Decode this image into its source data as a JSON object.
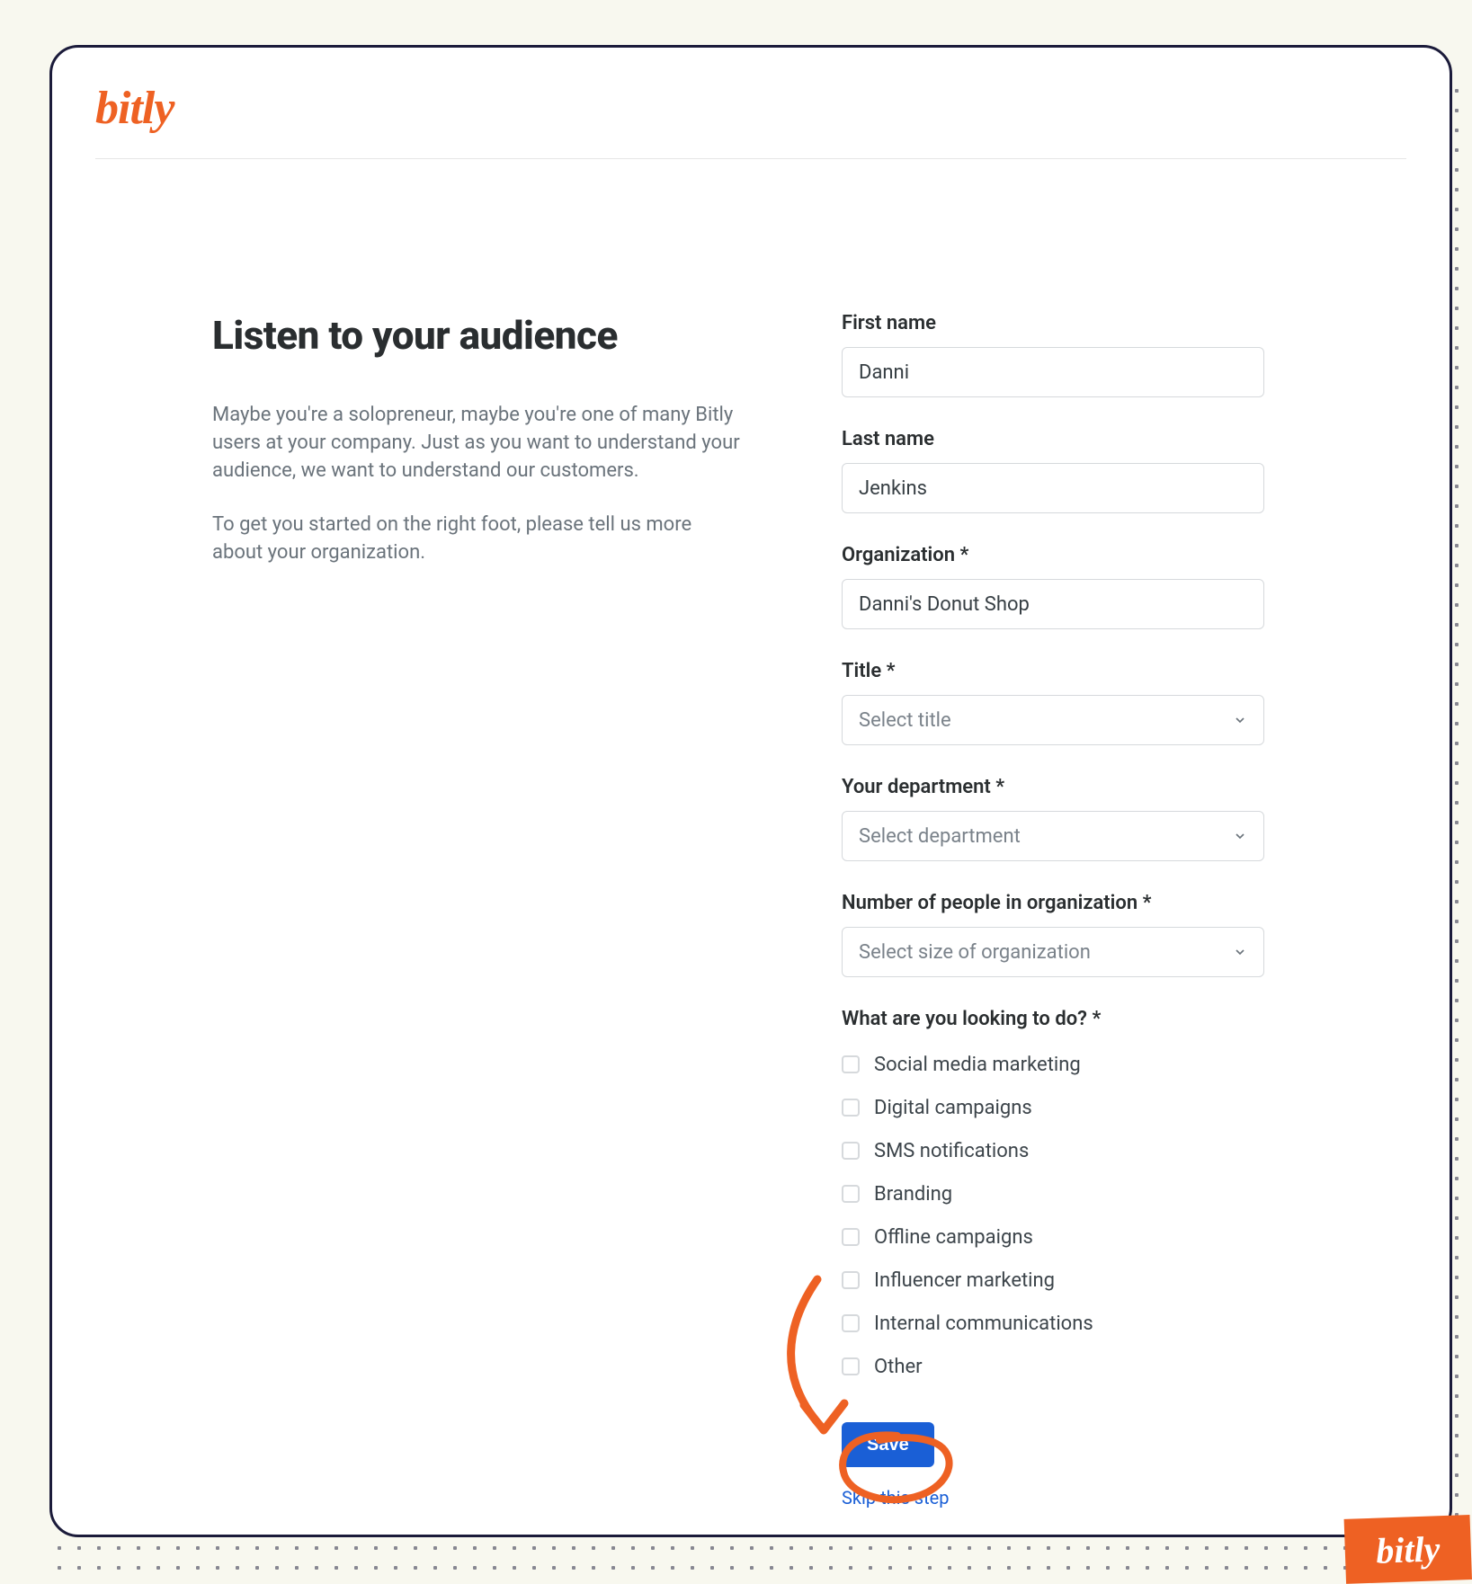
{
  "brand": "bitly",
  "page": {
    "title": "Listen to your audience",
    "intro_p1": "Maybe you're a solopreneur, maybe you're one of many Bitly users at your company. Just as you want to understand your audience, we want to understand our customers.",
    "intro_p2": "To get you started on the right foot, please tell us more about your organization."
  },
  "form": {
    "first_name": {
      "label": "First name",
      "value": "Danni"
    },
    "last_name": {
      "label": "Last name",
      "value": "Jenkins"
    },
    "organization": {
      "label": "Organization *",
      "value": "Danni's Donut Shop"
    },
    "title": {
      "label": "Title *",
      "placeholder": "Select title"
    },
    "department": {
      "label": "Your department *",
      "placeholder": "Select department"
    },
    "org_size": {
      "label": "Number of people in organization *",
      "placeholder": "Select size of organization"
    },
    "looking_to_do": {
      "label": "What are you looking to do? *",
      "options": [
        "Social media marketing",
        "Digital campaigns",
        "SMS notifications",
        "Branding",
        "Offline campaigns",
        "Influencer marketing",
        "Internal communications",
        "Other"
      ]
    },
    "save_label": "Save",
    "skip_label": "Skip this step"
  },
  "colors": {
    "brand_orange": "#ee6123",
    "accent_blue": "#1a5fd6",
    "ink": "#1b1b3a",
    "cream": "#f8f8ef"
  },
  "annotations": {
    "arrow": "hand-drawn-arrow",
    "circle": "hand-drawn-circle-around-save"
  }
}
